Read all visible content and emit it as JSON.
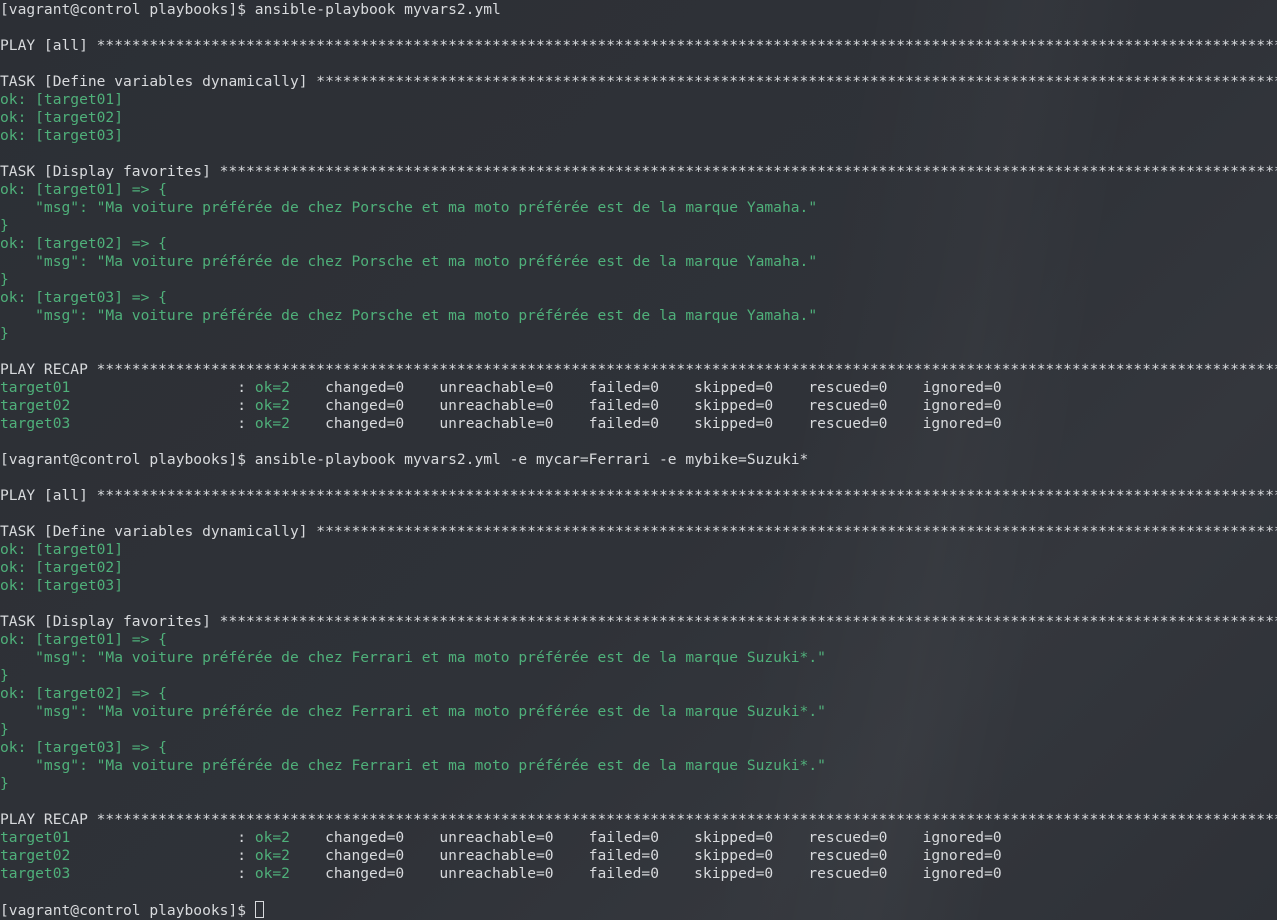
{
  "colors": {
    "background": "#2f3238",
    "text": "#d8dadd",
    "ok": "#4fb07a"
  },
  "lines": [
    {
      "type": "prompt",
      "text": "[vagrant@control playbooks]$ ansible-playbook myvars2.yml"
    },
    {
      "type": "blank"
    },
    {
      "type": "header",
      "text": "PLAY [all] ************************************************************************************************************************************************"
    },
    {
      "type": "blank"
    },
    {
      "type": "header",
      "text": "TASK [Define variables dynamically] ***************************************************************************************************************************"
    },
    {
      "type": "ok",
      "text": "ok: [target01]"
    },
    {
      "type": "ok",
      "text": "ok: [target02]"
    },
    {
      "type": "ok",
      "text": "ok: [target03]"
    },
    {
      "type": "blank"
    },
    {
      "type": "header",
      "text": "TASK [Display favorites] ******************************************************************************************************************************"
    },
    {
      "type": "ok",
      "text": "ok: [target01] => {"
    },
    {
      "type": "ok",
      "text": "    \"msg\": \"Ma voiture préférée de chez Porsche et ma moto préférée est de la marque Yamaha.\""
    },
    {
      "type": "ok",
      "text": "}"
    },
    {
      "type": "ok",
      "text": "ok: [target02] => {"
    },
    {
      "type": "ok",
      "text": "    \"msg\": \"Ma voiture préférée de chez Porsche et ma moto préférée est de la marque Yamaha.\""
    },
    {
      "type": "ok",
      "text": "}"
    },
    {
      "type": "ok",
      "text": "ok: [target03] => {"
    },
    {
      "type": "ok",
      "text": "    \"msg\": \"Ma voiture préférée de chez Porsche et ma moto préférée est de la marque Yamaha.\""
    },
    {
      "type": "ok",
      "text": "}"
    },
    {
      "type": "blank"
    },
    {
      "type": "header",
      "text": "PLAY RECAP ***************************************************************************************************************************************************"
    },
    {
      "type": "recap",
      "host": "target01",
      "sep": "                   : ",
      "ok": "ok=2",
      "rest": "    changed=0    unreachable=0    failed=0    skipped=0    rescued=0    ignored=0"
    },
    {
      "type": "recap",
      "host": "target02",
      "sep": "                   : ",
      "ok": "ok=2",
      "rest": "    changed=0    unreachable=0    failed=0    skipped=0    rescued=0    ignored=0"
    },
    {
      "type": "recap",
      "host": "target03",
      "sep": "                   : ",
      "ok": "ok=2",
      "rest": "    changed=0    unreachable=0    failed=0    skipped=0    rescued=0    ignored=0"
    },
    {
      "type": "blank"
    },
    {
      "type": "prompt",
      "text": "[vagrant@control playbooks]$ ansible-playbook myvars2.yml -e mycar=Ferrari -e mybike=Suzuki*"
    },
    {
      "type": "blank"
    },
    {
      "type": "header",
      "text": "PLAY [all] ************************************************************************************************************************************************"
    },
    {
      "type": "blank"
    },
    {
      "type": "header",
      "text": "TASK [Define variables dynamically] ***************************************************************************************************************************"
    },
    {
      "type": "ok",
      "text": "ok: [target01]"
    },
    {
      "type": "ok",
      "text": "ok: [target02]"
    },
    {
      "type": "ok",
      "text": "ok: [target03]"
    },
    {
      "type": "blank"
    },
    {
      "type": "header",
      "text": "TASK [Display favorites] ******************************************************************************************************************************"
    },
    {
      "type": "ok",
      "text": "ok: [target01] => {"
    },
    {
      "type": "ok",
      "text": "    \"msg\": \"Ma voiture préférée de chez Ferrari et ma moto préférée est de la marque Suzuki*.\""
    },
    {
      "type": "ok",
      "text": "}"
    },
    {
      "type": "ok",
      "text": "ok: [target02] => {"
    },
    {
      "type": "ok",
      "text": "    \"msg\": \"Ma voiture préférée de chez Ferrari et ma moto préférée est de la marque Suzuki*.\""
    },
    {
      "type": "ok",
      "text": "}"
    },
    {
      "type": "ok",
      "text": "ok: [target03] => {"
    },
    {
      "type": "ok",
      "text": "    \"msg\": \"Ma voiture préférée de chez Ferrari et ma moto préférée est de la marque Suzuki*.\""
    },
    {
      "type": "ok",
      "text": "}"
    },
    {
      "type": "blank"
    },
    {
      "type": "header",
      "text": "PLAY RECAP ***************************************************************************************************************************************************"
    },
    {
      "type": "recap",
      "host": "target01",
      "sep": "                   : ",
      "ok": "ok=2",
      "rest": "    changed=0    unreachable=0    failed=0    skipped=0    rescued=0    ignored=0"
    },
    {
      "type": "recap",
      "host": "target02",
      "sep": "                   : ",
      "ok": "ok=2",
      "rest": "    changed=0    unreachable=0    failed=0    skipped=0    rescued=0    ignored=0"
    },
    {
      "type": "recap",
      "host": "target03",
      "sep": "                   : ",
      "ok": "ok=2",
      "rest": "    changed=0    unreachable=0    failed=0    skipped=0    rescued=0    ignored=0"
    },
    {
      "type": "blank"
    },
    {
      "type": "final_prompt",
      "text": "[vagrant@control playbooks]$ "
    }
  ]
}
